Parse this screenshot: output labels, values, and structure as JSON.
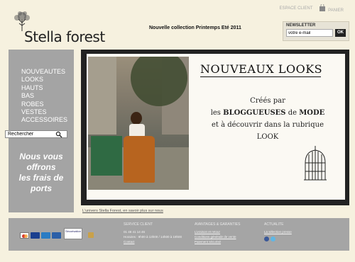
{
  "header": {
    "logo_text": "Stella forest",
    "headline": "Nouvelle collection Printemps Eté 2011",
    "espace_client": "ESPACE CLIENT",
    "panier": "PANIER"
  },
  "newsletter": {
    "label": "NEWSLETTER",
    "placeholder": "votre e-mail",
    "button": "OK"
  },
  "sidebar": {
    "menu": [
      "NOUVEAUTES",
      "LOOKS",
      "HAUTS",
      "BAS",
      "ROBES",
      "VESTES",
      "ACCESSOIRES"
    ],
    "search_value": "Rechercher",
    "promo": [
      "Nous vous",
      "offrons",
      "les frais de",
      "ports"
    ]
  },
  "banner": {
    "title": "NOUVEAUX LOOKS",
    "line1": "Créés par",
    "line2_pre": "les ",
    "line2_b1": "BLOGGUEUSES",
    "line2_mid": " de ",
    "line2_b2": "MODE",
    "line3": "et à découvrir dans la rubrique",
    "line4": "LOOK"
  },
  "univers_link": "L'univers Stella Forest, en savoir plus sur nous",
  "footer": {
    "cert": "Sécurisation",
    "service": {
      "heading": "SERVICE CLIENT",
      "phone": "01 48 41 14 46",
      "hours": "Horaires : 9h00 à 13h00 / 14h00 à 19h00",
      "contact": "Contact"
    },
    "avantages": {
      "heading": "AVANTAGES & GARANTIES",
      "l1": "Livraison et retour",
      "l2": "Conditions générale de vente",
      "l3": "Paiement sécurisé"
    },
    "actualite": {
      "heading": "ACTUALITE",
      "l1": "La sélection presse"
    },
    "colors": {
      "visa": "#1a3f8f",
      "mastercard": "#d8382f",
      "amex": "#2a7cc4",
      "other": "#2b5fa8",
      "facebook": "#3b5998",
      "twitter": "#5fb7e5"
    }
  }
}
